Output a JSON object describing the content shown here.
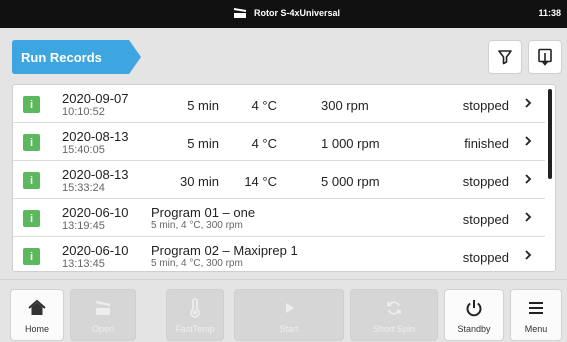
{
  "status_bar": {
    "rotor": "Rotor S-4xUniversal",
    "time": "11:38"
  },
  "header": {
    "title": "Run Records",
    "accent_color": "#3da6e0"
  },
  "records": [
    {
      "date": "2020-09-07",
      "time": "10:10:52",
      "duration": "5 min",
      "temp": "4 °C",
      "speed": "300 rpm",
      "status": "stopped"
    },
    {
      "date": "2020-08-13",
      "time": "15:40:05",
      "duration": "5 min",
      "temp": "4 °C",
      "speed": "1 000 rpm",
      "status": "finished"
    },
    {
      "date": "2020-08-13",
      "time": "15:33:24",
      "duration": "30 min",
      "temp": "14 °C",
      "speed": "5 000 rpm",
      "status": "stopped"
    },
    {
      "date": "2020-06-10",
      "time": "13:19:45",
      "program": "Program 01 – one",
      "program_detail": "5 min, 4 °C, 300 rpm",
      "status": "stopped"
    },
    {
      "date": "2020-06-10",
      "time": "13:13:45",
      "program": "Program 02 – Maxiprep 1",
      "program_detail": "5 min, 4 °C, 300 rpm",
      "status": "stopped"
    }
  ],
  "nav": {
    "home": "Home",
    "open": "Open",
    "fasttemp": "FastTemp",
    "start": "Start",
    "short_spin": "Short Spin",
    "standby": "Standby",
    "menu": "Menu"
  }
}
